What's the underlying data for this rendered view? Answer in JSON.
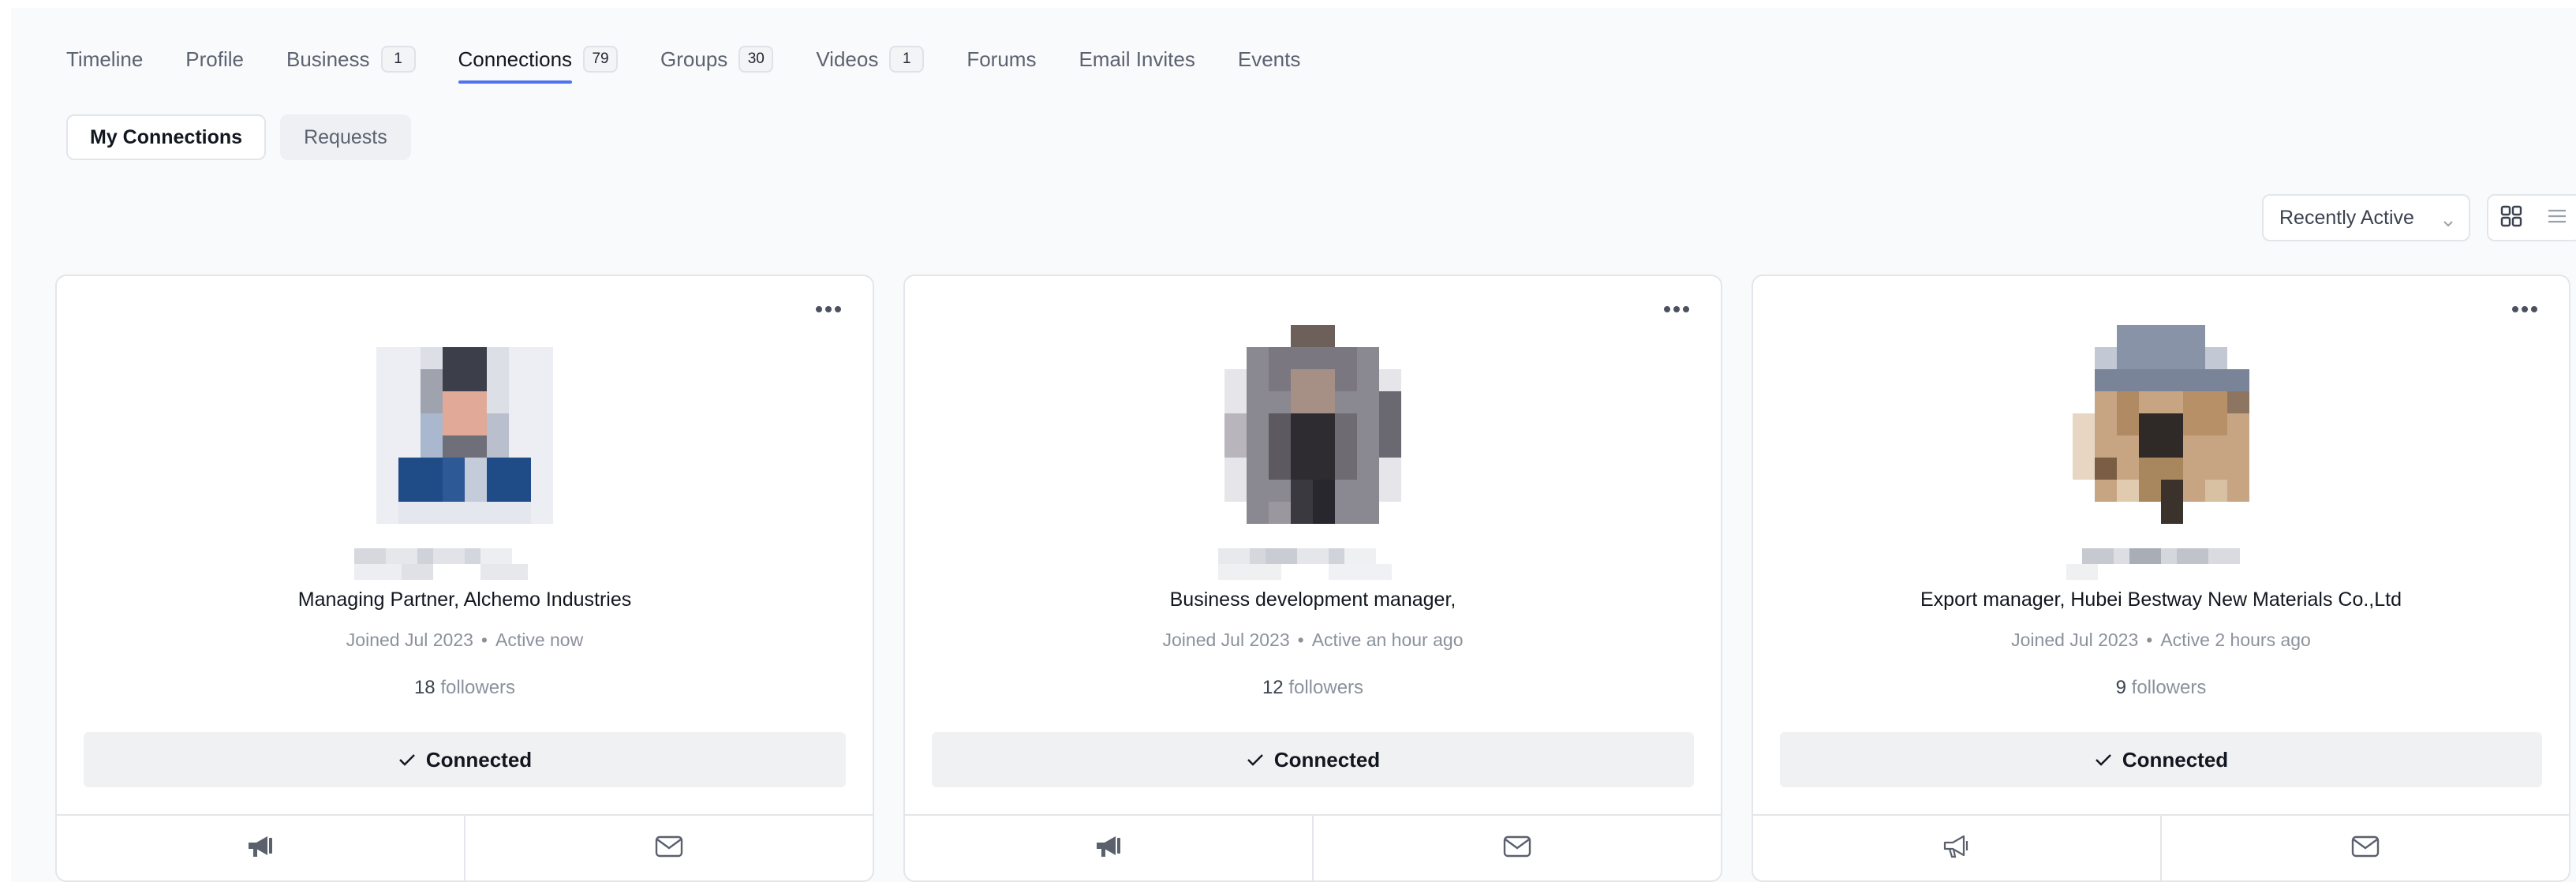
{
  "nav": [
    {
      "label": "Timeline",
      "badge": null
    },
    {
      "label": "Profile",
      "badge": null
    },
    {
      "label": "Business",
      "badge": "1"
    },
    {
      "label": "Connections",
      "badge": "79",
      "active": true
    },
    {
      "label": "Groups",
      "badge": "30"
    },
    {
      "label": "Videos",
      "badge": "1"
    },
    {
      "label": "Forums",
      "badge": null
    },
    {
      "label": "Email Invites",
      "badge": null
    },
    {
      "label": "Events",
      "badge": null
    }
  ],
  "subtabs": {
    "active": "My Connections",
    "inactive": "Requests"
  },
  "sort": {
    "selected": "Recently Active",
    "chevron_icon": "chevron-down-icon"
  },
  "view": {
    "grid_icon": "grid-icon",
    "list_icon": "list-icon",
    "active": "grid"
  },
  "cards": [
    {
      "title": "Managing Partner, Alchemo Industries",
      "joined": "Joined Jul 2023",
      "active": "Active now",
      "followers_count": "18",
      "followers_label": "followers",
      "button": "Connected",
      "follow_icon": "megaphone-filled-icon"
    },
    {
      "title": "Business development manager,",
      "joined": "Joined Jul 2023",
      "active": "Active an hour ago",
      "followers_count": "12",
      "followers_label": "followers",
      "button": "Connected",
      "follow_icon": "megaphone-filled-icon"
    },
    {
      "title": "Export manager, Hubei Bestway New Materials Co.,Ltd",
      "joined": "Joined Jul 2023",
      "active": "Active 2 hours ago",
      "followers_count": "9",
      "followers_label": "followers",
      "button": "Connected",
      "follow_icon": "megaphone-outline-icon"
    }
  ],
  "colors": {
    "accent": "#4f72f0",
    "background": "#f9fafb",
    "card_border": "#e3e6ea",
    "connected_bg": "#f0f1f3",
    "muted_text": "#8b919c"
  }
}
